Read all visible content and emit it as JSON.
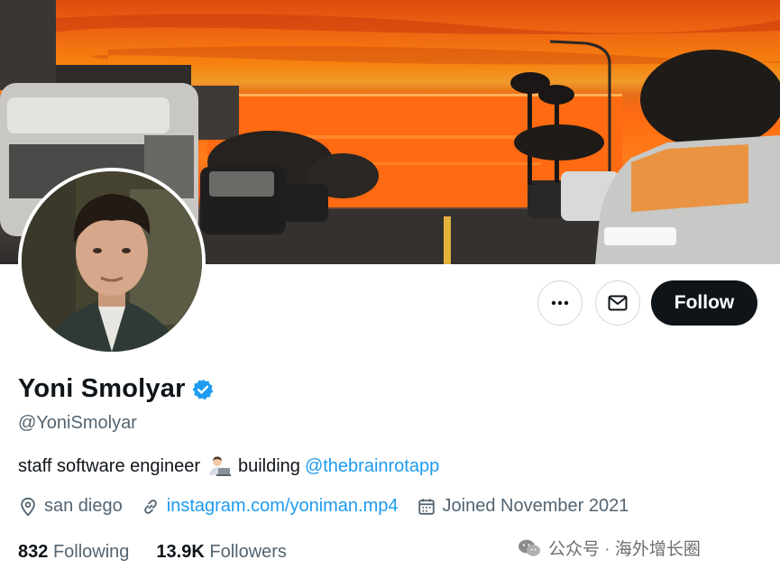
{
  "profile": {
    "name": "Yoni Smolyar",
    "handle": "@YoniSmolyar",
    "bio_text": "staff software engineer",
    "bio_building": "building",
    "bio_link": "@thebrainrotapp",
    "location": "san diego",
    "website": "instagram.com/yoniman.mp4",
    "joined": "Joined November 2021",
    "following_count": "832",
    "following_label": "Following",
    "followers_count": "13.9K",
    "followers_label": "Followers"
  },
  "actions": {
    "follow_label": "Follow"
  },
  "watermark": {
    "text": "公众号 · 海外增长圈"
  },
  "icons": {
    "more": "more-icon",
    "message": "envelope-icon",
    "verified": "verified-badge-icon",
    "location": "location-pin-icon",
    "link": "link-icon",
    "calendar": "calendar-icon",
    "bio_emoji": "technologist-emoji"
  },
  "colors": {
    "accent": "#1d9bf0",
    "text_primary": "#0f1419",
    "text_secondary": "#536471",
    "follow_bg": "#0f1419"
  }
}
